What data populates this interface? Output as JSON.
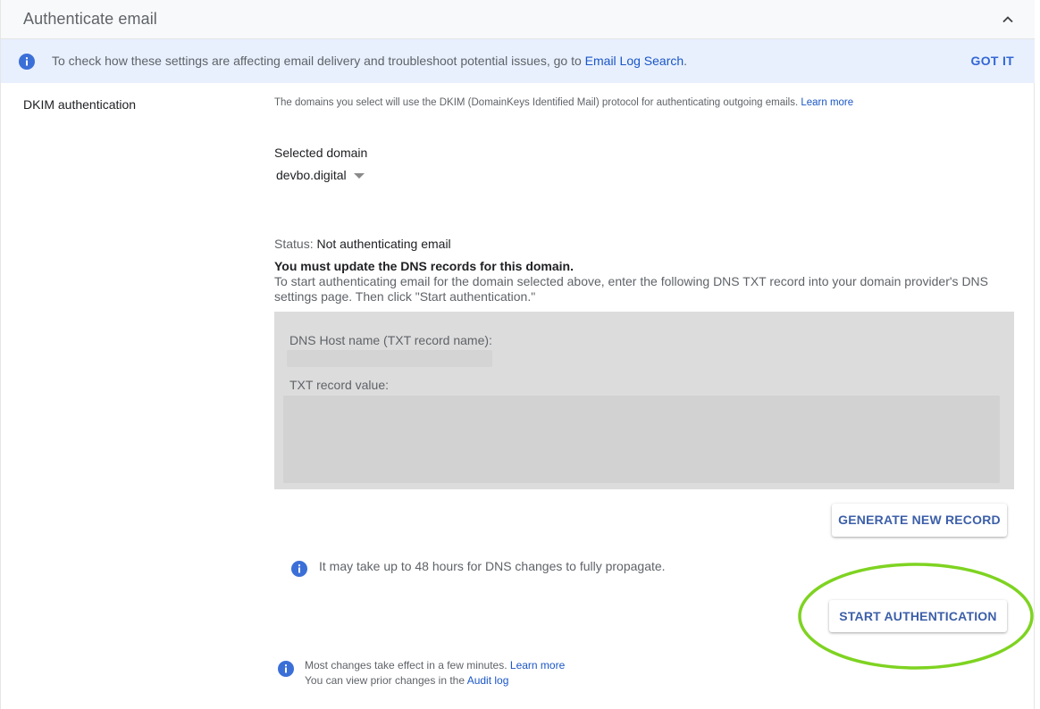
{
  "header": {
    "title": "Authenticate email",
    "collapse_icon": "chevron-up-icon"
  },
  "banner": {
    "icon": "info-icon",
    "text": "To check how these settings are affecting email delivery and troubleshoot potential issues, go to ",
    "link": "Email Log Search",
    "suffix": ".",
    "dismiss_label": "GOT IT"
  },
  "section": {
    "label": "DKIM authentication",
    "description": "The domains you select will use the DKIM (DomainKeys Identified Mail) protocol for authenticating outgoing emails. ",
    "description_link": "Learn more"
  },
  "domain": {
    "label": "Selected domain",
    "value": "devbo.digital"
  },
  "status": {
    "prefix": "Status: ",
    "value": "Not authenticating email",
    "must_update": "You must update the DNS records for this domain.",
    "instructions": "To start authenticating email for the domain selected above, enter the following DNS TXT record into your domain provider's DNS settings page. Then click \"Start authentication.\""
  },
  "dns": {
    "host_label": "DNS Host name (TXT record name):",
    "txt_label": "TXT record value:"
  },
  "buttons": {
    "generate": "GENERATE NEW RECORD",
    "start": "START AUTHENTICATION"
  },
  "propagation": {
    "text": "It may take up to 48 hours for DNS changes to fully propagate."
  },
  "footer": {
    "line1_text": "Most changes take effect in a few minutes. ",
    "line1_link": "Learn more",
    "line2_text": "You can view prior changes in the ",
    "line2_link": "Audit log"
  },
  "colors": {
    "accent": "#3367d6",
    "banner_bg": "#e8f0fe",
    "highlight": "#7ed321",
    "info_icon": "#3b6fd8"
  }
}
